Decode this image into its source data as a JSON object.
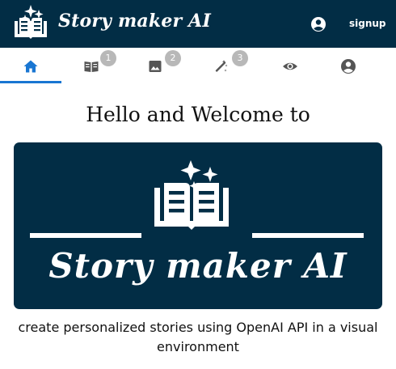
{
  "header": {
    "brand": "Story maker AI",
    "signup_label": "signup",
    "account_icon": "account-circle-icon",
    "logo_icon": "open-book-sparkles-icon"
  },
  "tabs": [
    {
      "icon": "home-icon",
      "badge": "",
      "selected": true
    },
    {
      "icon": "book-icon",
      "badge": "1",
      "selected": false
    },
    {
      "icon": "image-icon",
      "badge": "2",
      "selected": false
    },
    {
      "icon": "magic-wand-icon",
      "badge": "3",
      "selected": false
    },
    {
      "icon": "eye-icon",
      "badge": "",
      "selected": false
    },
    {
      "icon": "account-circle-icon",
      "badge": "",
      "selected": false
    }
  ],
  "main": {
    "welcome": "Hello and Welcome to",
    "hero_title": "Story maker AI",
    "description": "create personalized stories using OpenAI API in a visual environment"
  },
  "colors": {
    "brand_navy": "#022d45",
    "active_tab": "#1976d2",
    "tab_icon": "#555555",
    "badge": "#b8b8b8"
  }
}
